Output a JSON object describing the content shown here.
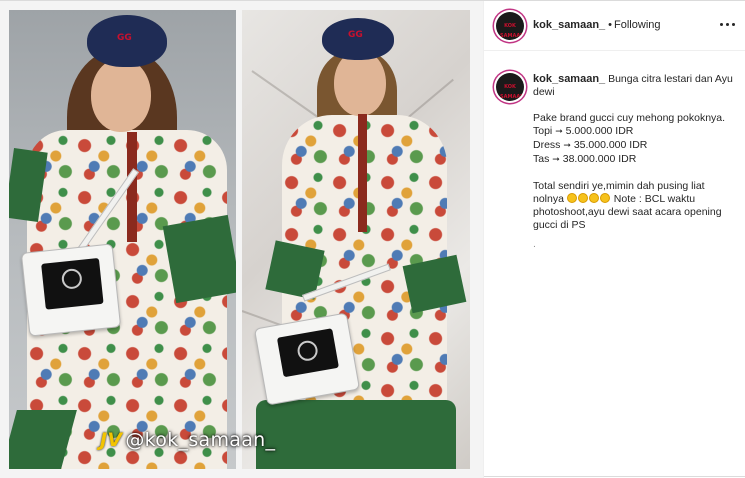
{
  "post": {
    "username": "kok_samaan_",
    "separator": "•",
    "follow_status": "Following",
    "avatar_text": "KOK SAMAAN",
    "watermark_mark": "JV",
    "watermark_text": "@kok_samaan_",
    "beret_logo": "GG"
  },
  "caption": {
    "username": "kok_samaan_",
    "line1": "Bunga citra lestari dan Ayu dewi",
    "line2": "Pake brand gucci cuy mehong pokoknya.",
    "topi_label": "Topi",
    "topi_value": "5.000.000 IDR",
    "dress_label": "Dress",
    "dress_value": "35.000.000 IDR",
    "tas_label": "Tas",
    "tas_value": "38.000.000 IDR",
    "arrow": "➞",
    "line3a": "Total sendiri ye,mimin dah pusing liat nolnya",
    "line3b": "Note : BCL waktu photoshoot,ayu dewi saat acara opening gucci di PS",
    "more": "."
  },
  "colors": {
    "text": "#262626",
    "muted": "#8e8e8e",
    "story_ring": "#c13584",
    "dress_band": "#2e6b3a",
    "beret": "#1f2c55"
  },
  "icons": [
    "more-options-icon",
    "grin-emoji-icon"
  ]
}
